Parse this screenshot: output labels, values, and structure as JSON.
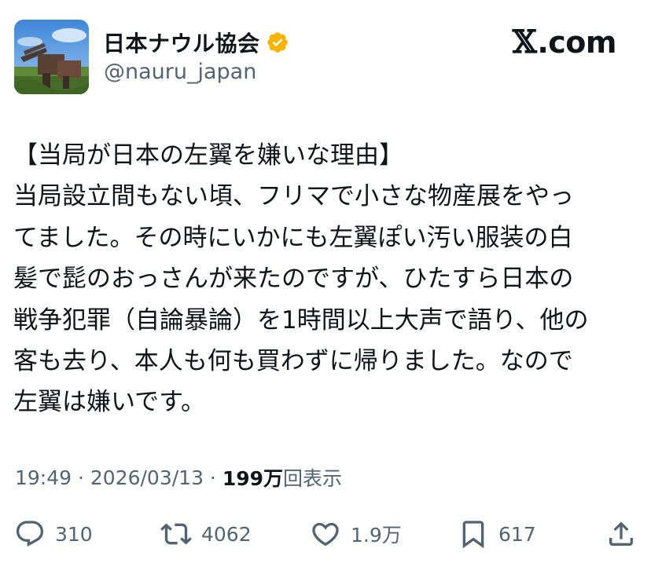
{
  "account": {
    "display_name": "日本ナウル協会",
    "handle": "@nauru_japan",
    "avatar_icon": "profile-photo",
    "verified_icon": "verified-badge-icon",
    "verified_color": "#f4b400"
  },
  "brand": {
    "logo": "𝕏",
    "domain": ".com"
  },
  "post": {
    "lines": [
      "【当局が日本の左翼を嫌いな理由】",
      "当局設立間もない頃、フリマで小さな物産展をやっ",
      "てました。その時にいかにも左翼ぽい汚い服装の白",
      "髪で髭のおっさんが来たのですが、ひたすら日本の",
      "戦争犯罪（自論暴論）を1時間以上大声で語り、他の",
      "客も去り、本人も何も買わずに帰りました。なので",
      "左翼は嫌いです。"
    ]
  },
  "meta": {
    "time": "19:49",
    "sep1": " · ",
    "date": "2026/03/13",
    "sep2": " · ",
    "views_count": "199万",
    "views_label": "回表示"
  },
  "actions": {
    "replies": "310",
    "reposts": "4062",
    "likes": "1.9万",
    "bookmarks": "617"
  },
  "colors": {
    "text": "#0f1419",
    "secondary": "#536471"
  }
}
